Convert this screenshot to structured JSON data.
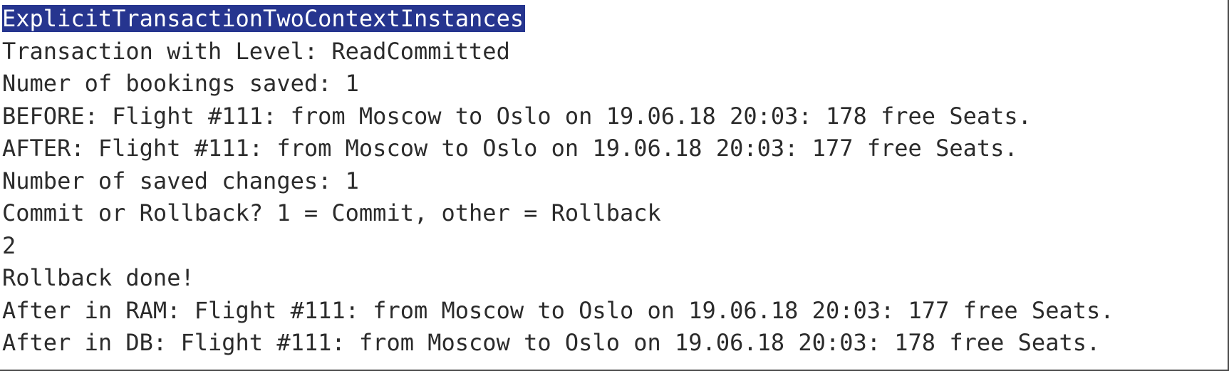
{
  "console": {
    "highlight_color": "#26358f",
    "text_color": "#2b2b2b",
    "lines": [
      "ExplicitTransactionTwoContextInstances",
      "Transaction with Level: ReadCommitted",
      "Numer of bookings saved: 1",
      "BEFORE: Flight #111: from Moscow to Oslo on 19.06.18 20:03: 178 free Seats.",
      "AFTER: Flight #111: from Moscow to Oslo on 19.06.18 20:03: 177 free Seats.",
      "Number of saved changes: 1",
      "Commit or Rollback? 1 = Commit, other = Rollback",
      "2",
      "Rollback done!",
      "After in RAM: Flight #111: from Moscow to Oslo on 19.06.18 20:03: 177 free Seats.",
      "After in DB: Flight #111: from Moscow to Oslo on 19.06.18 20:03: 178 free Seats."
    ]
  }
}
